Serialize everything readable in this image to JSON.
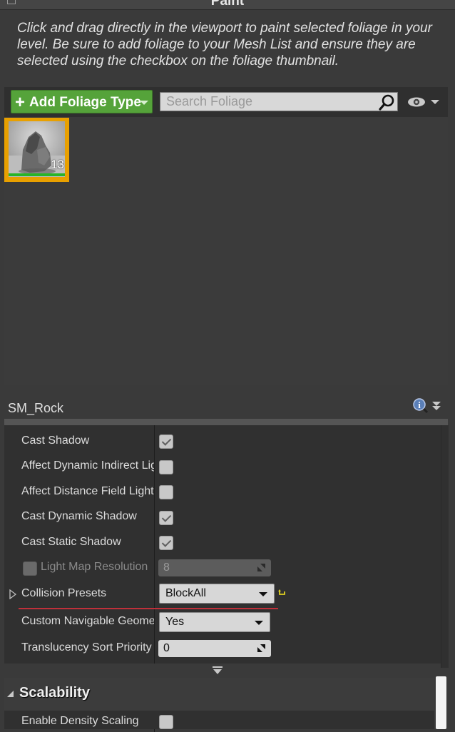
{
  "panel": {
    "title": "Paint"
  },
  "instructions": "Click and drag directly in the viewport to paint selected foliage in your level. Be sure to add foliage to your Mesh List and ensure they are selected using the checkbox on the foliage thumbnail.",
  "toolbar": {
    "add_label": "Add Foliage Type",
    "search_placeholder": "Search Foliage"
  },
  "foliage": {
    "items": [
      {
        "count": "13"
      }
    ]
  },
  "details": {
    "title": "SM_Rock",
    "properties": [
      {
        "label": "Cast Shadow",
        "checked": true
      },
      {
        "label": "Affect Dynamic Indirect Lighting",
        "checked": false
      },
      {
        "label": "Affect Distance Field Lighting",
        "checked": false
      },
      {
        "label": "Cast Dynamic Shadow",
        "checked": true
      },
      {
        "label": "Cast Static Shadow",
        "checked": true
      },
      {
        "label": "Light Map Resolution",
        "value": "8",
        "enabled": false
      },
      {
        "label": "Collision Presets",
        "value": "BlockAll"
      },
      {
        "label": "Custom Navigable Geometry",
        "value": "Yes"
      },
      {
        "label": "Translucency Sort Priority",
        "value": "0"
      }
    ]
  },
  "scalability": {
    "title": "Scalability",
    "properties": [
      {
        "label": "Enable Density Scaling",
        "checked": false
      }
    ]
  },
  "colors": {
    "accent_green": "#55a33a",
    "selection_orange": "#e8a000",
    "panel_bg": "#3a3a3a",
    "error_red": "#c0303a"
  }
}
